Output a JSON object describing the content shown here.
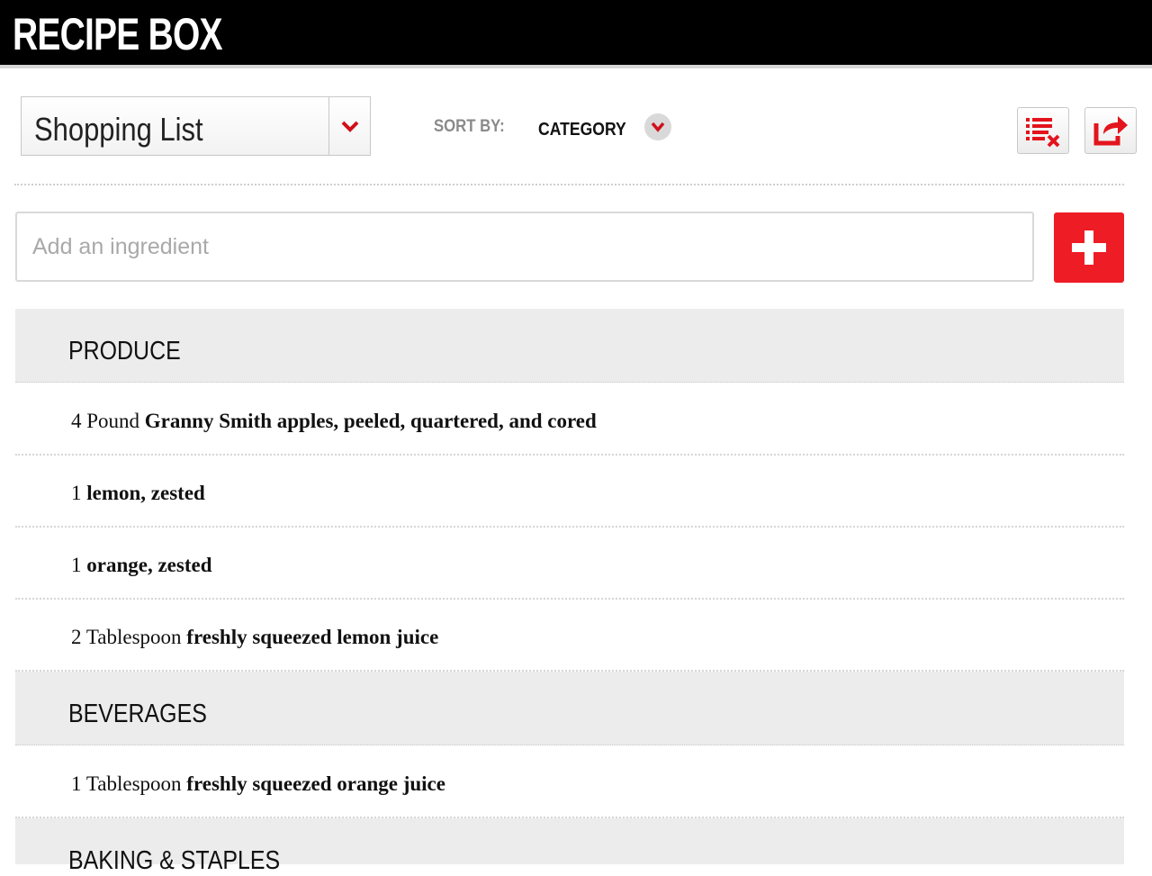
{
  "header": {
    "title": "RECIPE BOX"
  },
  "toolbar": {
    "list_selector_value": "Shopping List",
    "sort_label": "SORT BY:",
    "sort_value": "CATEGORY",
    "icons": {
      "dropdown": "chevron-down-icon",
      "clear": "clear-list-icon",
      "share": "share-icon",
      "add": "plus-icon"
    }
  },
  "add_ingredient": {
    "placeholder": "Add an ingredient"
  },
  "colors": {
    "accent": "#ee1c25",
    "header_bg": "#000000",
    "category_bg": "#ececec"
  },
  "categories": [
    {
      "name": "PRODUCE",
      "items": [
        {
          "qty": "4 Pound",
          "name": "Granny Smith apples, peeled, quartered, and cored"
        },
        {
          "qty": "1",
          "name": "lemon, zested"
        },
        {
          "qty": "1",
          "name": "orange, zested"
        },
        {
          "qty": "2 Tablespoon",
          "name": "freshly squeezed lemon juice"
        }
      ]
    },
    {
      "name": "BEVERAGES",
      "items": [
        {
          "qty": "1 Tablespoon",
          "name": "freshly squeezed orange juice"
        }
      ]
    },
    {
      "name": "BAKING & STAPLES",
      "items": []
    }
  ]
}
